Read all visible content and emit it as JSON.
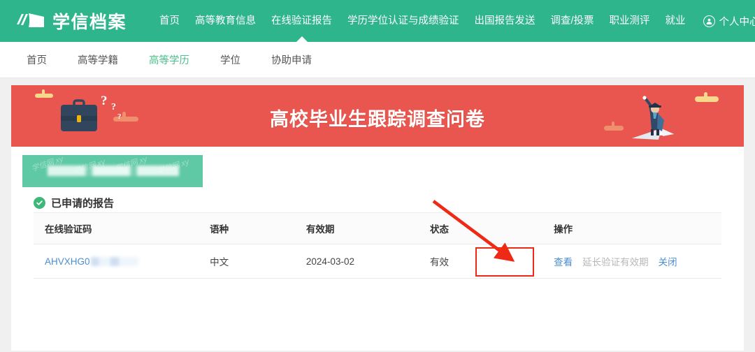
{
  "colors": {
    "header_green": "#2fb58b",
    "banner_red": "#e9564f",
    "accent_green": "#4ec08c",
    "link_blue": "#4a8ed1",
    "annotation_red": "#ee2a17",
    "blur_green": "#5ec9a4"
  },
  "header": {
    "logo_text": "学信档案",
    "logo_icon": "chsi-book-logo-icon",
    "nav": [
      {
        "label": "首页",
        "active": false
      },
      {
        "label": "高等教育信息",
        "active": false
      },
      {
        "label": "在线验证报告",
        "active": true
      },
      {
        "label": "学历学位认证与成绩验证",
        "active": false
      },
      {
        "label": "出国报告发送",
        "active": false
      },
      {
        "label": "调查/投票",
        "active": false
      },
      {
        "label": "职业测评",
        "active": false
      },
      {
        "label": "就业",
        "active": false
      }
    ],
    "user": {
      "label": "个人中心",
      "icon": "user-circle-icon",
      "caret": "chevron-down-icon"
    }
  },
  "sub_nav": {
    "items": [
      {
        "label": "首页",
        "active": false
      },
      {
        "label": "高等学籍",
        "active": false
      },
      {
        "label": "高等学历",
        "active": true
      },
      {
        "label": "学位",
        "active": false
      },
      {
        "label": "协助申请",
        "active": false
      }
    ]
  },
  "banner": {
    "title": "高校毕业生跟踪调查问卷",
    "left_art": "briefcase-question-marks-illustration",
    "right_art": "graduate-on-paper-plane-illustration"
  },
  "blurred_box": {
    "watermark_text": "学信网 xy",
    "redacted": true
  },
  "section": {
    "icon": "check-circle-icon",
    "title": "已申请的报告"
  },
  "table": {
    "columns": [
      "在线验证码",
      "语种",
      "有效期",
      "状态",
      "操作"
    ],
    "rows": [
      {
        "code": "AHVXHG0",
        "code_redacted": true,
        "language": "中文",
        "valid_until": "2024-03-02",
        "status": "有效",
        "actions": [
          {
            "label": "查看",
            "state": "link",
            "highlighted": true
          },
          {
            "label": "延长验证有效期",
            "state": "disabled",
            "highlighted": false
          },
          {
            "label": "关闭",
            "state": "link",
            "highlighted": false
          }
        ]
      }
    ]
  },
  "annotations": {
    "arrow": "red-arrow-pointing-to-view-button",
    "highlight": "red-rectangle-around-view-button"
  }
}
